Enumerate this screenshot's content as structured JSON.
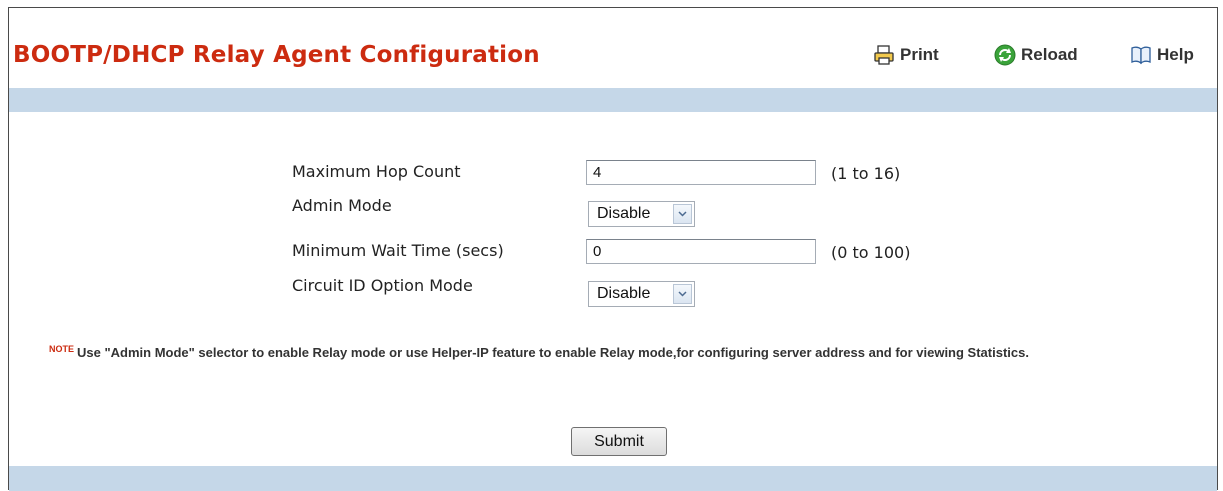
{
  "header": {
    "title": "BOOTP/DHCP Relay Agent Configuration",
    "print_label": "Print",
    "reload_label": "Reload",
    "help_label": "Help"
  },
  "form": {
    "max_hop_count": {
      "label": "Maximum Hop Count",
      "value": "4",
      "range": "(1 to 16)"
    },
    "admin_mode": {
      "label": "Admin Mode",
      "selected": "Disable"
    },
    "min_wait_time": {
      "label": "Minimum Wait Time (secs)",
      "value": "0",
      "range": "(0 to 100)"
    },
    "circuit_id_option_mode": {
      "label": "Circuit ID Option Mode",
      "selected": "Disable"
    }
  },
  "note": {
    "label": "NOTE",
    "text": "Use \"Admin Mode\" selector to enable Relay mode or use Helper-IP feature to enable Relay mode,for configuring server address and for viewing Statistics."
  },
  "actions": {
    "submit_label": "Submit"
  },
  "icons": {
    "print": "printer-icon",
    "reload": "reload-icon",
    "help": "help-book-icon",
    "dropdown": "chevron-down-icon"
  },
  "colors": {
    "title": "#cc2b10",
    "band": "#c5d7e8",
    "reload_icon": "#3aa33a"
  }
}
